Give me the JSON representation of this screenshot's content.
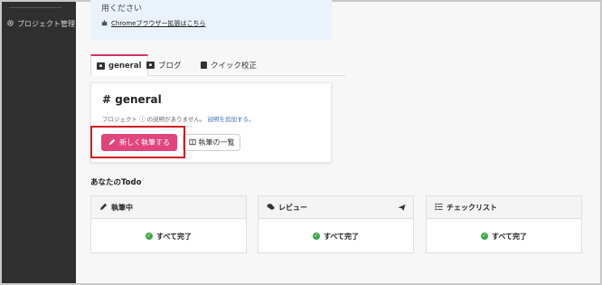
{
  "sidebar": {
    "project_label": "プロジェクト管理"
  },
  "info": {
    "line1": "用ください",
    "extension_link": "Chromeブラウザー拡張はこちら"
  },
  "tabs": [
    {
      "label": "general"
    },
    {
      "label": "ブログ"
    },
    {
      "label": "クイック校正"
    }
  ],
  "channel": {
    "title": "# general",
    "desc_prefix": "プロジェクト",
    "desc_middle": "の説明がありません。",
    "add_desc_link": "説明を追加する。",
    "write_button": "新しく執筆する",
    "list_button": "執筆の一覧"
  },
  "todo": {
    "heading": "あなたのTodo",
    "panels": [
      {
        "title": "執筆中",
        "status": "すべて完了"
      },
      {
        "title": "レビュー",
        "status": "すべて完了"
      },
      {
        "title": "チェックリスト",
        "status": "すべて完了"
      }
    ]
  },
  "colors": {
    "accent": "#e0457b",
    "highlight": "#d41f1f",
    "sidebar": "#2f2f2f",
    "check": "#3fa94a"
  }
}
